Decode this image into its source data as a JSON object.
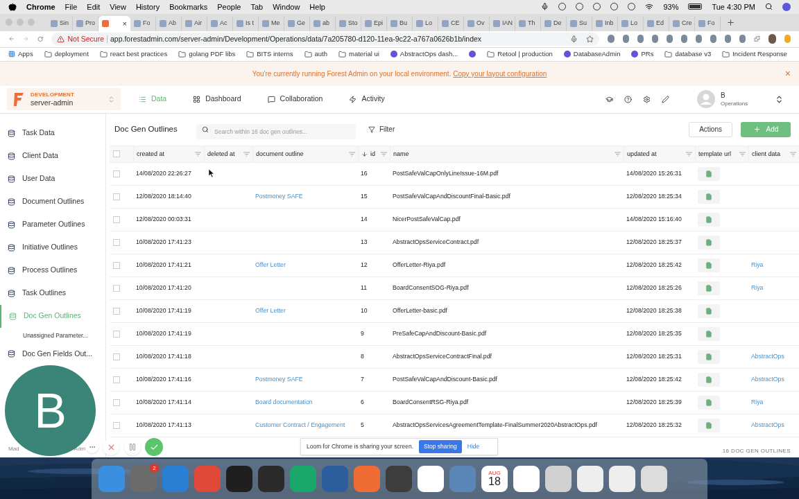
{
  "menu_bar": {
    "app": "Chrome",
    "items": [
      "File",
      "Edit",
      "View",
      "History",
      "Bookmarks",
      "People",
      "Tab",
      "Window",
      "Help"
    ],
    "battery": "93%",
    "clock": "Tue 4:30 PM"
  },
  "tabs": [
    {
      "label": "Sin",
      "selected": false
    },
    {
      "label": "Pro",
      "selected": false
    },
    {
      "selected": true,
      "close": "×"
    },
    {
      "label": "Fo",
      "selected": false
    },
    {
      "label": "Ab",
      "selected": false
    },
    {
      "label": "Air",
      "selected": false
    },
    {
      "label": "Ac",
      "selected": false
    },
    {
      "label": "Is t",
      "selected": false
    },
    {
      "label": "Me",
      "selected": false
    },
    {
      "label": "Ge",
      "selected": false
    },
    {
      "label": "ab",
      "selected": false
    },
    {
      "label": "Sto",
      "selected": false
    },
    {
      "label": "Epi",
      "selected": false
    },
    {
      "label": "Bu",
      "selected": false
    },
    {
      "label": "Lo",
      "selected": false
    },
    {
      "label": "CE",
      "selected": false
    },
    {
      "label": "Ov",
      "selected": false
    },
    {
      "label": "IAN",
      "selected": false
    },
    {
      "label": "Th",
      "selected": false
    },
    {
      "label": "De",
      "selected": false
    },
    {
      "label": "Su",
      "selected": false
    },
    {
      "label": "Inb",
      "selected": false
    },
    {
      "label": "Lo",
      "selected": false
    },
    {
      "label": "Ed",
      "selected": false
    },
    {
      "label": "Cre",
      "selected": false
    },
    {
      "label": "Fo",
      "selected": false
    }
  ],
  "address_bar": {
    "security": "Not Secure",
    "url": "app.forestadmin.com/server-admin/Development/Operations/data/7a205780-d120-11ea-9c22-a767a0626b1b/index"
  },
  "bookmarks": [
    {
      "label": "Apps",
      "kind": "apps"
    },
    {
      "label": "deployment",
      "kind": "folder"
    },
    {
      "label": "react best practices",
      "kind": "folder"
    },
    {
      "label": "golang PDF libs",
      "kind": "folder"
    },
    {
      "label": "BITS interns",
      "kind": "folder"
    },
    {
      "label": "auth",
      "kind": "folder"
    },
    {
      "label": "material ui",
      "kind": "folder"
    },
    {
      "label": "AbstractOps dash...",
      "kind": "site"
    },
    {
      "kind": "site"
    },
    {
      "label": "Retool | production",
      "kind": "folder"
    },
    {
      "label": "DatabaseAdmin",
      "kind": "site"
    },
    {
      "label": "PRs",
      "kind": "site"
    },
    {
      "label": "database v3",
      "kind": "folder"
    },
    {
      "label": "Incident Response",
      "kind": "folder"
    }
  ],
  "banner": {
    "text": "You're currently running Forest Admin on your local environment.",
    "link": "Copy your layout configuration",
    "close": "×"
  },
  "header": {
    "environment": "DEVELOPMENT",
    "project": "server-admin",
    "nav": [
      {
        "label": "Data",
        "selected": true
      },
      {
        "label": "Dashboard",
        "selected": false
      },
      {
        "label": "Collaboration",
        "selected": false
      },
      {
        "label": "Activity",
        "selected": false
      }
    ],
    "user": {
      "name": "B",
      "team": "Operations"
    }
  },
  "sidebar": {
    "items": [
      {
        "label": "Task Data",
        "kind": "collection",
        "selected": false
      },
      {
        "label": "Client Data",
        "kind": "collection",
        "selected": false
      },
      {
        "label": "User Data",
        "kind": "collection",
        "selected": false
      },
      {
        "label": "Document Outlines",
        "kind": "collection",
        "selected": false
      },
      {
        "label": "Parameter Outlines",
        "kind": "collection",
        "selected": false
      },
      {
        "label": "Initiative Outlines",
        "kind": "collection",
        "selected": false
      },
      {
        "label": "Process Outlines",
        "kind": "collection",
        "selected": false
      },
      {
        "label": "Task Outlines",
        "kind": "collection",
        "selected": false
      },
      {
        "label": "Doc Gen Outlines",
        "kind": "collection",
        "selected": true
      },
      {
        "label": "Unassigned Parameter...",
        "kind": "segment",
        "selected": false
      },
      {
        "label": "Doc Gen Fields Out...",
        "kind": "collection",
        "selected": false
      }
    ],
    "footer": [
      "Mad",
      "Adm"
    ]
  },
  "toolbar": {
    "title": "Doc Gen Outlines",
    "search": {
      "placeholder": "Search within 16 doc gen outlines..."
    },
    "filter": "Filter",
    "actions": "Actions",
    "add": "Add"
  },
  "table": {
    "select_all_checked": false,
    "columns": [
      {
        "label": "created at",
        "sort_descending": false
      },
      {
        "label": "deleted at",
        "sort_descending": false
      },
      {
        "label": "document outline",
        "sort_descending": false
      },
      {
        "label": "id",
        "sort_descending": true
      },
      {
        "label": "name",
        "sort_descending": false
      },
      {
        "label": "updated at",
        "sort_descending": false
      },
      {
        "label": "template url",
        "sort_descending": false
      },
      {
        "label": "client data",
        "sort_descending": false
      }
    ],
    "rows": [
      {
        "checked": false,
        "created_at": "14/08/2020 22:26:27",
        "id": "16",
        "name": "PostSafeValCapOnlyLineIssue-16M.pdf",
        "updated_at": "14/08/2020 15:26:31",
        "template_file": true
      },
      {
        "checked": false,
        "created_at": "12/08/2020 18:14:40",
        "document_outline": "Postmoney SAFE",
        "id": "15",
        "name": "PostSafeValCapAndDiscountFinal-Basic.pdf",
        "updated_at": "12/08/2020 18:25:34",
        "template_file": true
      },
      {
        "checked": false,
        "created_at": "12/08/2020 00:03:31",
        "id": "14",
        "name": "NicerPostSafeValCap.pdf",
        "updated_at": "14/08/2020 15:16:40",
        "template_file": true
      },
      {
        "checked": false,
        "created_at": "10/08/2020 17:41:23",
        "id": "13",
        "name": "AbstractOpsServiceContract.pdf",
        "updated_at": "12/08/2020 18:25:37",
        "template_file": true
      },
      {
        "checked": false,
        "created_at": "10/08/2020 17:41:21",
        "document_outline": "Offer Letter",
        "id": "12",
        "name": "OfferLetter-Riya.pdf",
        "updated_at": "12/08/2020 18:25:42",
        "template_file": true,
        "client_data": "Riya"
      },
      {
        "checked": false,
        "created_at": "10/08/2020 17:41:20",
        "id": "11",
        "name": "BoardConsentSOG-Riya.pdf",
        "updated_at": "12/08/2020 18:25:26",
        "template_file": true,
        "client_data": "Riya"
      },
      {
        "checked": false,
        "created_at": "10/08/2020 17:41:19",
        "document_outline": "Offer Letter",
        "id": "10",
        "name": "OfferLetter-basic.pdf",
        "updated_at": "12/08/2020 18:25:38",
        "template_file": true
      },
      {
        "checked": false,
        "created_at": "10/08/2020 17:41:19",
        "id": "9",
        "name": "PreSafeCapAndDiscount-Basic.pdf",
        "updated_at": "12/08/2020 18:25:35",
        "template_file": true
      },
      {
        "checked": false,
        "created_at": "10/08/2020 17:41:18",
        "id": "8",
        "name": "AbstractOpsServiceContractFinal.pdf",
        "updated_at": "12/08/2020 18:25:31",
        "template_file": true,
        "client_data": "AbstractOps"
      },
      {
        "checked": false,
        "created_at": "10/08/2020 17:41:16",
        "document_outline": "Postmoney SAFE",
        "id": "7",
        "name": "PostSafeValCapAndDiscount-Basic.pdf",
        "updated_at": "12/08/2020 18:25:42",
        "template_file": true,
        "client_data": "AbstractOps"
      },
      {
        "checked": false,
        "created_at": "10/08/2020 17:41:14",
        "document_outline": "Board documentation",
        "id": "6",
        "name": "BoardConsentRSG-Riya.pdf",
        "updated_at": "12/08/2020 18:25:39",
        "template_file": true,
        "client_data": "Riya"
      },
      {
        "checked": false,
        "created_at": "10/08/2020 17:41:13",
        "document_outline": "Customer Contract / Engagement",
        "id": "5",
        "name": "AbstractOpsServicesAgreementTemplate-FinalSummer2020AbstractOps.pdf",
        "updated_at": "12/08/2020 18:25:32",
        "template_file": true,
        "client_data": "AbstractOps"
      }
    ],
    "count": "16 DOC GEN OUTLINES"
  },
  "recorder": {
    "avatar": "B",
    "sharing_text": "Loom for Chrome is sharing your screen.",
    "stop": "Stop sharing",
    "hide": "Hide"
  },
  "dock": [
    {
      "color": "#3b8fe0"
    },
    {
      "color": "#6b6b6b",
      "badge": "2"
    },
    {
      "color": "#2a7fd4"
    },
    {
      "color": "#e0493a"
    },
    {
      "color": "#1f1f1f"
    },
    {
      "color": "#2b2b2b"
    },
    {
      "color": "#19a86a"
    },
    {
      "color": "#2c5e9e"
    },
    {
      "color": "#ef6c35"
    },
    {
      "color": "#3d3d3d"
    },
    {
      "color": "#ffffff"
    },
    {
      "color": "#5a86b8"
    },
    {
      "color": "#ffffff",
      "month": "AUG",
      "day": "18"
    },
    {
      "color": "#ffffff"
    },
    {
      "color": "#d0d0d0"
    },
    {
      "color": "#eeeeee"
    },
    {
      "color": "#eeeeee"
    },
    {
      "color": "#dcdcdc"
    }
  ]
}
